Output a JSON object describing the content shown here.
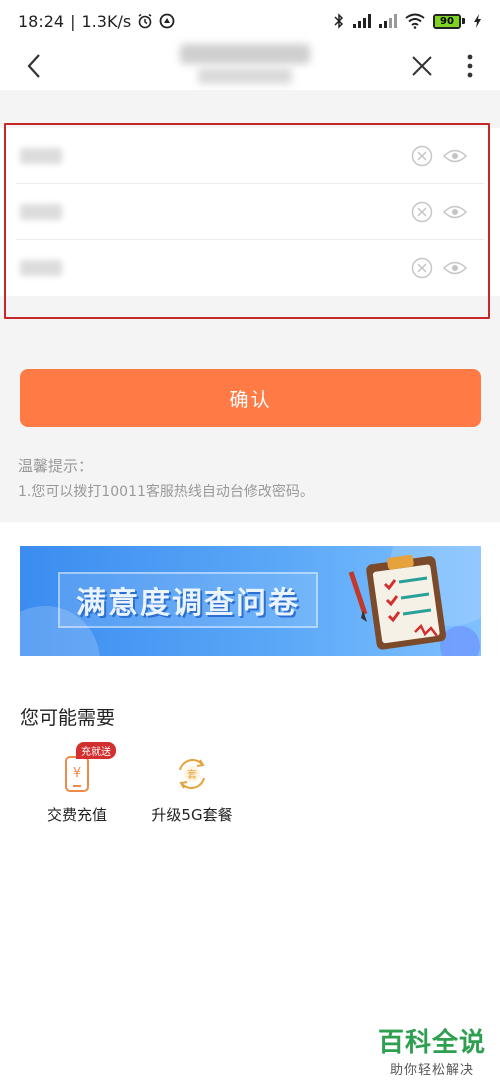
{
  "status_bar": {
    "time": "18:24",
    "speed": "1.3K/s",
    "battery": "90"
  },
  "nav": {
    "back_icon": "chevron-left-icon",
    "close_icon": "close-icon",
    "more_icon": "more-vertical-icon"
  },
  "form": {
    "rows": [
      {
        "value": ""
      },
      {
        "value": ""
      },
      {
        "value": ""
      }
    ],
    "clear_icon": "clear-circle-icon",
    "eye_icon": "eye-icon"
  },
  "confirm": {
    "label": "确认"
  },
  "tips": {
    "title": "温馨提示：",
    "lines": [
      "1.您可以拨打10011客服热线自动台修改密码。"
    ]
  },
  "banner": {
    "title": "满意度调查问卷"
  },
  "recommend": {
    "title": "您可能需要",
    "items": [
      {
        "label": "交费充值",
        "badge": "充就送",
        "icon": "phone-yuan-icon"
      },
      {
        "label": "升级5G套餐",
        "icon": "package-upgrade-icon"
      }
    ]
  },
  "watermark": {
    "main": "百科全说",
    "sub": "助你轻松解决"
  },
  "colors": {
    "accent": "#ff7a45",
    "highlight": "#c62828",
    "banner_blue": "#3b8cf0",
    "watermark_green": "#2e9e4f"
  }
}
